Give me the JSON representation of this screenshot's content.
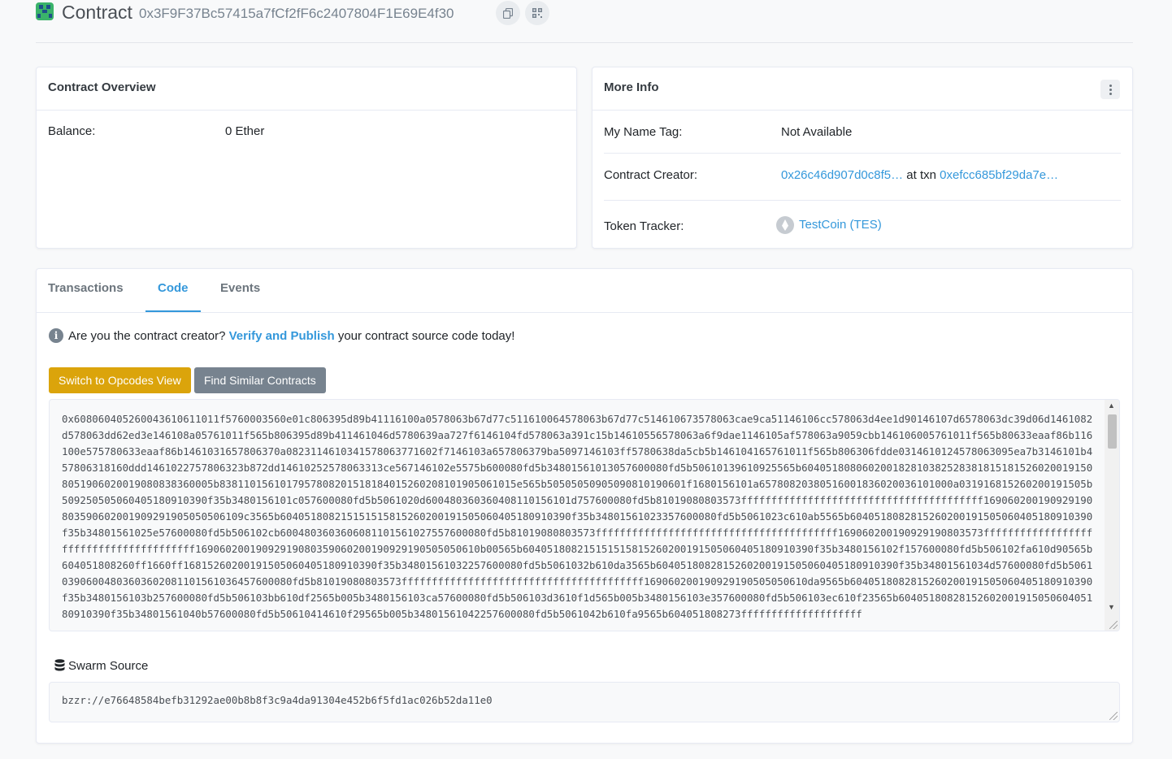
{
  "header": {
    "title": "Contract",
    "address": "0x3F9F37Bc57415a7fCf2fF6c2407804F1E69E4f30",
    "copy_icon": "copy-icon",
    "qr_icon": "qr-code-icon"
  },
  "overview": {
    "title": "Contract Overview",
    "balance_label": "Balance:",
    "balance_value": "0 Ether"
  },
  "more_info": {
    "title": "More Info",
    "name_tag_label": "My Name Tag:",
    "name_tag_value": "Not Available",
    "creator_label": "Contract Creator:",
    "creator_address": "0x26c46d907d0c8f5…",
    "creator_at_txn": "at txn",
    "creator_txn": "0xefcc685bf29da7e…",
    "token_label": "Token Tracker:",
    "token_value": "TestCoin (TES)"
  },
  "tabs": [
    {
      "label": "Transactions",
      "active": false
    },
    {
      "label": "Code",
      "active": true
    },
    {
      "label": "Events",
      "active": false
    }
  ],
  "code_tab": {
    "notice_prefix": "Are you the contract creator?",
    "notice_link": "Verify and Publish",
    "notice_suffix": "your contract source code today!",
    "opcodes_button": "Switch to Opcodes View",
    "similar_button": "Find Similar Contracts",
    "bytecode": "0x608060405260043610611011f5760003560e01c806395d89b41116100a0578063b67d77c511610064578063b67d77c514610673578063cae9ca51146106cc578063d4ee1d90146107d6578063dc39d06d1461082d578063dd62ed3e146108a05761011f565b806395d89b411461046d5780639aa727f6146104fd578063a391c15b14610556578063a6f9dae1146105af578063a9059cbb146106005761011f565b80633eaaf86b116100e57578063 3eaaf86b14610316578063 70a082311461034157806377 1602f7146103a657806379ba5097146103ff5780638da5cb5b14610416576101 1f565b806306fdde0314610124578063095ea7b3146101b457806318160ddd146102275780 6323b872dd1461025257806331 3ce567146102e5575b600080fd5b34801561013057600080fd5b5061013961092556 5b604051808060200182810382528381815181526020019150805190602001908083836000 5b838110156101795780820151818401526020810190506101 5e565b50505050905090810190601f1680156101a6578082038051600183602003610100 0a031916815260200191505b50925050506040518091039 0f35b3480156101c057600080fd5b5061020d60048036036040811015610 1d757600080fd5b81019080803573ffffffffffffffffffffffffffffffffffffffff16906020019092919080359060200190929190505050610 9c3565b604051808215151515815260200191505060405180910390f35b348015610233576000 80fd5b5061023c610ab5565b6040518082815260200191505060405180910390f35b34801561025e57600080fd5b506102cb600480360360608110156 1027557600080fd5b81019080803573ffffffffffffffffffffffffffffffffffffffff16906020019092919080357 3ffffffffffffffffffffffffffffffffffffffff16906020019092919080359060200190929190505050610b00565b604051808215151515815260200191505060405180910390f35b3480156102f157600080fd5b506102fa610d90565b6040518082 60ff1660ff16815260200191505060405180910390f35b348015610322 57600080fd5b5061032b610da3565b6040518082815260200191505060405180910390f35b34801561034d57600080fd5b50610390600480360360208110156103 6457600080fd5b81019080803573ffffffffffffffffffffffffffffffffffffffff169060200190929190505050610da9565b6040518082815260200191505060405180910390f35b3480156103b257600080fd5b506103bb610df2565b005b3480156103ca57600080fd5b506103d3610f1d565b005b3480156103e357600080fd5b506103ec610f23565b6040518082815260200191505060405180910390f35b34801561040b57600080fd5b5061041461 0f29565b005b34801561042257600080fd5b5061042b610fa9565b604051808273ffffffffffffffffffff",
    "swarm_label": "Swarm Source",
    "swarm_value": "bzzr://e76648584befb31292ae00b8b8f3c9a4da91304e452b6f5fd1ac026b52da11e0"
  },
  "colors": {
    "link": "#3498db",
    "warning_button": "#dba40b",
    "secondary_button": "#77838f"
  }
}
